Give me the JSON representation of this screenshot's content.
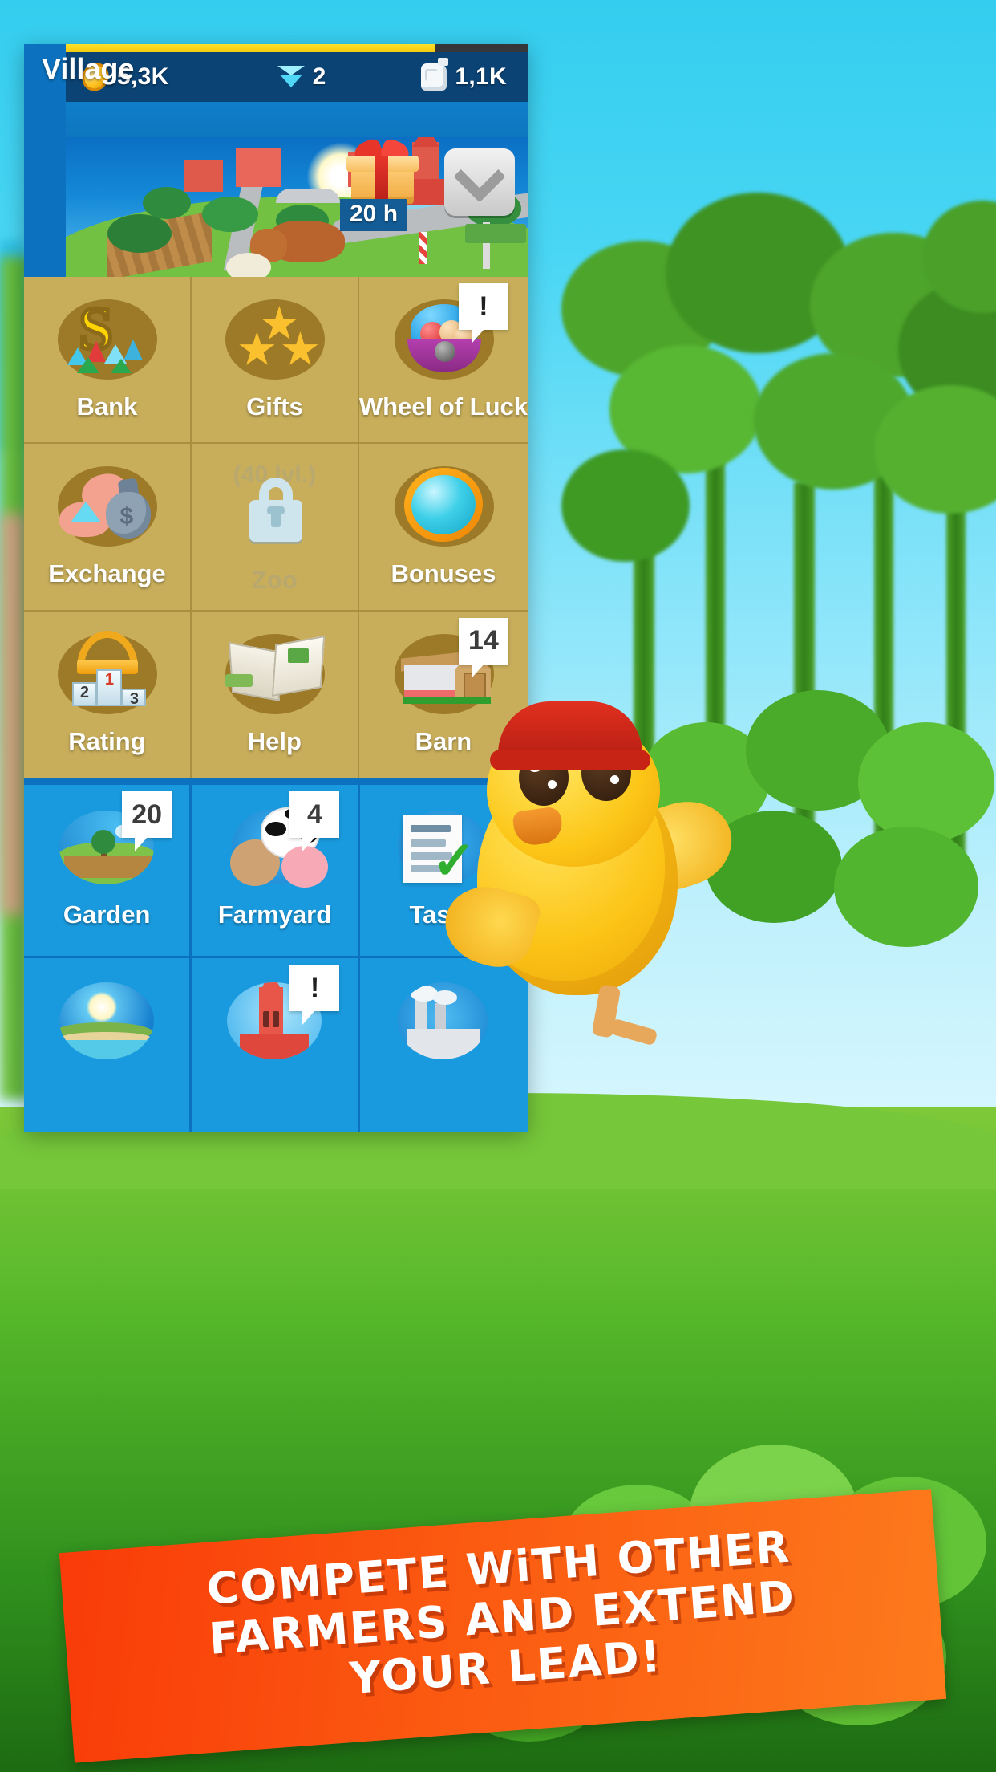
{
  "resources": {
    "coins": {
      "icon": "coin-icon",
      "value": "5,3K"
    },
    "gems": {
      "icon": "gem-icon",
      "value": "2"
    },
    "milk": {
      "icon": "milk-can-icon",
      "value": "1,1K"
    }
  },
  "header": {
    "title": "Village",
    "gift": {
      "icon": "gift-box-icon",
      "timer": "20 h"
    },
    "collapse_button": {
      "icon": "chevron-down-icon"
    }
  },
  "menu": {
    "gold_section": [
      {
        "label": "Bank",
        "icon": "bank-icon",
        "badge": null,
        "locked": false,
        "lvl": null
      },
      {
        "label": "Gifts",
        "icon": "stars-icon",
        "badge": null,
        "locked": false,
        "lvl": null
      },
      {
        "label": "Wheel of Luck",
        "icon": "lottery-wheel-icon",
        "badge": "!",
        "locked": false,
        "lvl": null
      },
      {
        "label": "Exchange",
        "icon": "exchange-icon",
        "badge": null,
        "locked": false,
        "lvl": null
      },
      {
        "label": "Zoo",
        "icon": "lock-icon",
        "badge": null,
        "locked": true,
        "lvl": "(40 lvl.)"
      },
      {
        "label": "Bonuses",
        "icon": "bonus-orb-icon",
        "badge": null,
        "locked": false,
        "lvl": null
      },
      {
        "label": "Rating",
        "icon": "podium-icon",
        "badge": null,
        "locked": false,
        "lvl": null
      },
      {
        "label": "Help",
        "icon": "book-icon",
        "badge": null,
        "locked": false,
        "lvl": null
      },
      {
        "label": "Barn",
        "icon": "barn-icon",
        "badge": "14",
        "locked": false,
        "lvl": null
      }
    ],
    "blue_section": [
      {
        "label": "Garden",
        "icon": "garden-icon",
        "badge": "20"
      },
      {
        "label": "Farmyard",
        "icon": "farmyard-icon",
        "badge": "4"
      },
      {
        "label": "Tasks",
        "icon": "tasks-icon",
        "badge": null
      },
      {
        "label": "",
        "icon": "island-icon",
        "badge": null
      },
      {
        "label": "",
        "icon": "town-icon",
        "badge": "!"
      },
      {
        "label": "",
        "icon": "factory-icon",
        "badge": null
      }
    ]
  },
  "banner": {
    "line1": "COMPETE WiTH OTHER",
    "line2": "FARMERS AND EXTEND",
    "line3": "YOUR LEAD!"
  },
  "colors": {
    "panel_blue": "#0c72bf",
    "topbar_blue": "#0b4375",
    "gold": "#c8ae5b",
    "blue_cell": "#1a9ade",
    "banner_orange": "#f93b09",
    "progress_yellow": "#ffe02a"
  }
}
